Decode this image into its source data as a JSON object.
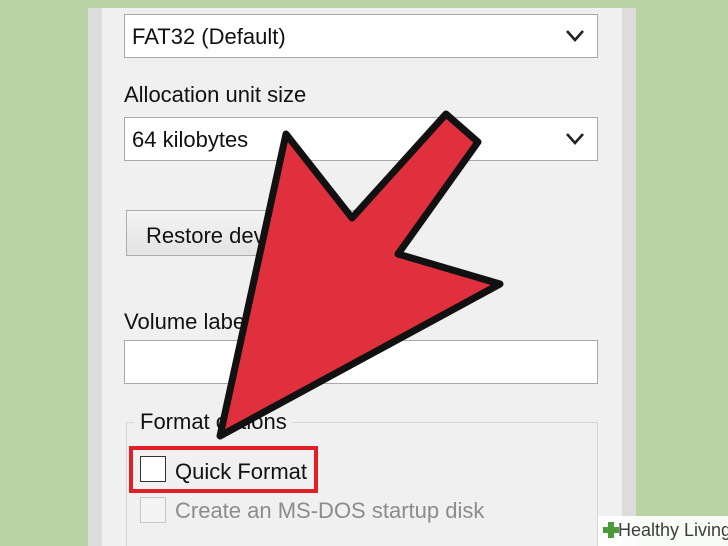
{
  "file_system": {
    "selected": "FAT32 (Default)"
  },
  "allocation": {
    "label": "Allocation unit size",
    "selected": "64 kilobytes"
  },
  "restore_button": {
    "label": "Restore dev"
  },
  "volume": {
    "label": "Volume labe",
    "value": ""
  },
  "format_options": {
    "legend": "Format options",
    "quick_format": {
      "label": "Quick Format",
      "checked": false
    },
    "msdos": {
      "label": "Create an MS-DOS startup disk",
      "checked": false,
      "disabled": true
    }
  },
  "annotation": {
    "arrow_color": "#e0303e",
    "highlight_color": "#e11f26"
  },
  "watermark": {
    "text": "Healthy Living",
    "icon": "plus-icon"
  }
}
